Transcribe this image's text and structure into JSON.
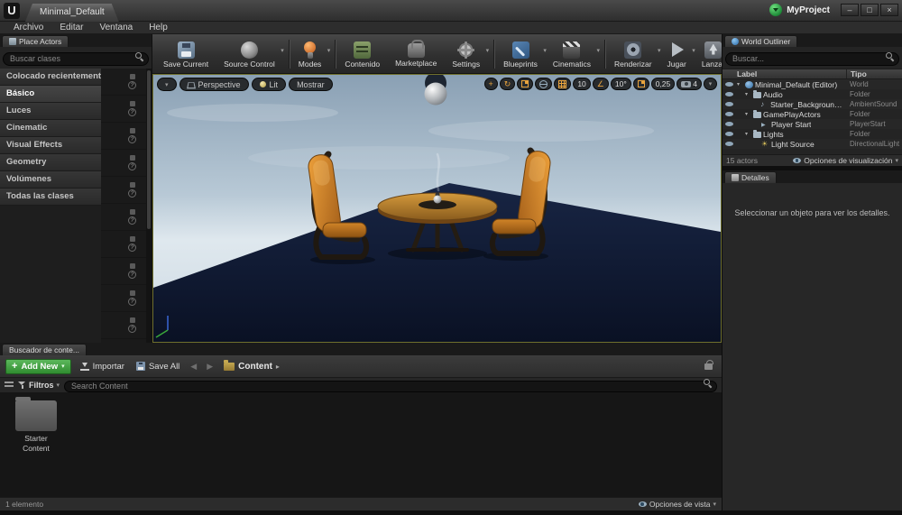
{
  "titlebar": {
    "logo": "U",
    "tab": "Minimal_Default",
    "project": "MyProject",
    "window_buttons": [
      "–",
      "□",
      "×"
    ]
  },
  "menubar": {
    "items": [
      "Archivo",
      "Editar",
      "Ventana",
      "Help"
    ]
  },
  "icons": {
    "caret_down": "▾",
    "question_mark": "?",
    "back_arrow": "◀",
    "forward_arrow": "▶",
    "breadcrumb_arrow": "▸"
  },
  "place_actors": {
    "tab": "Place Actors",
    "search_placeholder": "Buscar clases",
    "categories": [
      {
        "label": "Colocado recientemente",
        "selected": false
      },
      {
        "label": "Básico",
        "selected": true
      },
      {
        "label": "Luces",
        "selected": false
      },
      {
        "label": "Cinematic",
        "selected": false
      },
      {
        "label": "Visual Effects",
        "selected": false
      },
      {
        "label": "Geometry",
        "selected": false
      },
      {
        "label": "Volúmenes",
        "selected": false
      },
      {
        "label": "Todas las clases",
        "selected": false
      }
    ],
    "thumbnails": [
      {
        "shape": "sphere"
      },
      {
        "shape": "capsule"
      },
      {
        "shape": "capsule"
      },
      {
        "shape": "sphere"
      },
      {
        "shape": "sphere"
      },
      {
        "shape": "cylinder"
      },
      {
        "shape": "sphere"
      },
      {
        "shape": "sphere"
      },
      {
        "shape": "cone"
      },
      {
        "shape": "cylinder"
      },
      {
        "shape": "sphere"
      }
    ]
  },
  "toolbar": {
    "buttons": [
      {
        "label": "Save Current",
        "icon": "save",
        "dropdown": false,
        "sep_after": false
      },
      {
        "label": "Source Control",
        "icon": "source",
        "dropdown": true,
        "sep_after": true
      },
      {
        "label": "Modes",
        "icon": "modes",
        "dropdown": true,
        "sep_after": true
      },
      {
        "label": "Contenido",
        "icon": "content",
        "dropdown": false,
        "sep_after": false
      },
      {
        "label": "Marketplace",
        "icon": "market",
        "dropdown": false,
        "sep_after": false
      },
      {
        "label": "Settings",
        "icon": "settings",
        "dropdown": true,
        "sep_after": true
      },
      {
        "label": "Blueprints",
        "icon": "blueprints",
        "dropdown": true,
        "sep_after": false
      },
      {
        "label": "Cinematics",
        "icon": "cinematics",
        "dropdown": true,
        "sep_after": true
      },
      {
        "label": "Renderizar",
        "icon": "render",
        "dropdown": true,
        "sep_after": false
      },
      {
        "label": "Jugar",
        "icon": "play",
        "dropdown": true,
        "sep_after": false
      },
      {
        "label": "Lanzar",
        "icon": "launch",
        "dropdown": true,
        "sep_after": false
      }
    ]
  },
  "viewport": {
    "mode_button": "Perspective",
    "lit_button": "Lit",
    "show_button": "Mostrar",
    "snaps": {
      "grid": "10",
      "angle": "10°",
      "scale": "0,25",
      "camera_speed": "4"
    }
  },
  "world_outliner": {
    "tab": "World Outliner",
    "search_placeholder": "Buscar...",
    "columns": {
      "label": "Label",
      "type": "Tipo"
    },
    "rows": [
      {
        "label": "Minimal_Default (Editor)",
        "type": "World",
        "indent": 0,
        "icon": "world",
        "expand": true
      },
      {
        "label": "Audio",
        "type": "Folder",
        "indent": 1,
        "icon": "folder",
        "expand": true
      },
      {
        "label": "Starter_Background_Cue",
        "type": "AmbientSound",
        "indent": 2,
        "icon": "sound",
        "expand": false
      },
      {
        "label": "GamePlayActors",
        "type": "Folder",
        "indent": 1,
        "icon": "folder",
        "expand": true
      },
      {
        "label": "Player Start",
        "type": "PlayerStart",
        "indent": 2,
        "icon": "player",
        "expand": false
      },
      {
        "label": "Lights",
        "type": "Folder",
        "indent": 1,
        "icon": "folder",
        "expand": true
      },
      {
        "label": "Light Source",
        "type": "DirectionalLight",
        "indent": 2,
        "icon": "light",
        "expand": false
      }
    ],
    "footer_left": "15 actors",
    "footer_right": "Opciones de visualización"
  },
  "details": {
    "tab": "Detalles",
    "empty_message": "Seleccionar un objeto para ver los detalles."
  },
  "content_browser": {
    "tab": "Buscador de conte...",
    "add_new": "Add New",
    "import_label": "Importar",
    "save_all": "Save All",
    "breadcrumb": "Content",
    "filters": "Filtros",
    "search_placeholder": "Search Content",
    "items": [
      {
        "label": "Starter Content"
      }
    ],
    "footer_left": "1 elemento",
    "footer_right": "Opciones de vista"
  },
  "colors": {
    "accent_orange": "#e8a33d",
    "add_new_green": "#3f9b3f",
    "viewport_border": "#6f6f2d",
    "chair_orange": "#d98a2b",
    "floor_navy": "#101a32"
  }
}
